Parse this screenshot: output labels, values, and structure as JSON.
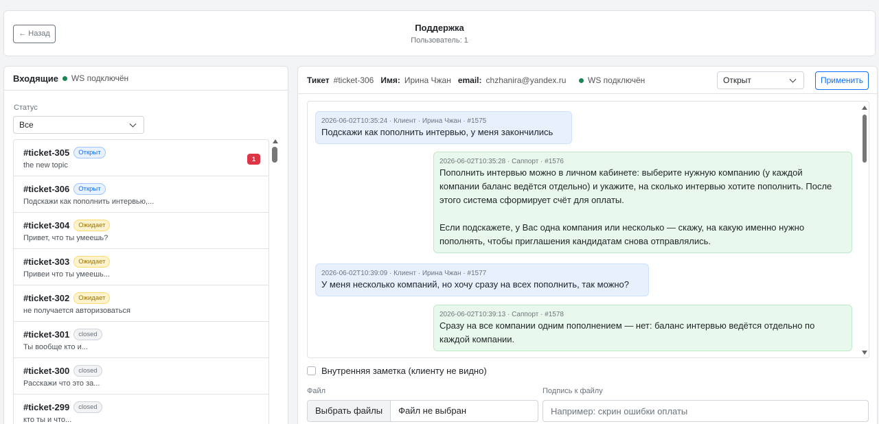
{
  "header": {
    "back_label": "← Назад",
    "title": "Поддержка",
    "subtitle": "Пользователь: 1"
  },
  "inbox": {
    "title": "Входящие",
    "ws_status": "WS подключён",
    "status_label": "Статус",
    "status_value": "Все",
    "tickets": [
      {
        "id": "#ticket-305",
        "status": "Открыт",
        "status_kind": "open",
        "preview": "the new topic",
        "unread": "1"
      },
      {
        "id": "#ticket-306",
        "status": "Открыт",
        "status_kind": "open",
        "preview": "Подскажи как пополнить интервью,..."
      },
      {
        "id": "#ticket-304",
        "status": "Ожидает",
        "status_kind": "wait",
        "preview": "Привет, что ты умеешь?"
      },
      {
        "id": "#ticket-303",
        "status": "Ожидает",
        "status_kind": "wait",
        "preview": "Привеи что ты умеешь..."
      },
      {
        "id": "#ticket-302",
        "status": "Ожидает",
        "status_kind": "wait",
        "preview": "не получается авторизоваться"
      },
      {
        "id": "#ticket-301",
        "status": "closed",
        "status_kind": "closed",
        "preview": "Ты вообще кто и..."
      },
      {
        "id": "#ticket-300",
        "status": "closed",
        "status_kind": "closed",
        "preview": "Расскажи что это за..."
      },
      {
        "id": "#ticket-299",
        "status": "closed",
        "status_kind": "closed",
        "preview": "кто ты и что..."
      }
    ]
  },
  "ticket": {
    "label": "Тикет",
    "id": "#ticket-306",
    "name_label": "Имя:",
    "name": "Ирина Чжан",
    "email_label": "email:",
    "email": "chzhanira@yandex.ru",
    "ws_status": "WS подключён",
    "status_value": "Открыт",
    "apply_label": "Применить",
    "messages": [
      {
        "role": "client",
        "meta": "2026-06-02T10:35:24 · Клиент · Ирина Чжан · #1575",
        "lines": [
          "Подскажи как пополнить интервью, у меня закончились"
        ]
      },
      {
        "role": "support",
        "meta": "2026-06-02T10:35:28 · Саппорт · #1576",
        "lines": [
          "Пополнить интервью можно в личном кабинете: выберите нужную компанию (у каждой",
          "компании баланс ведётся отдельно) и укажите, на сколько интервью хотите пополнить. После",
          "этого система сформирует счёт для оплаты.",
          "",
          "Если подскажете, у Вас одна компания или несколько — скажу, на какую именно нужно",
          "пополнять, чтобы приглашения кандидатам снова отправлялись."
        ]
      },
      {
        "role": "client",
        "meta": "2026-06-02T10:39:09 · Клиент · Ирина Чжан · #1577",
        "lines": [
          "У меня несколько компаний, но хочу сразу на всех пополнить, так можно?"
        ]
      },
      {
        "role": "support",
        "meta": "2026-06-02T10:39:13 · Саппорт · #1578",
        "lines": [
          "Сразу на все компании одним пополнением — нет: баланс интервью ведётся отдельно по",
          "каждой компании."
        ]
      }
    ],
    "internal_note_label": "Внутренняя заметка (клиенту не видно)",
    "file_label": "Файл",
    "file_button": "Выбрать файлы",
    "file_none": "Файл не выбран",
    "caption_label": "Подпись к файлу",
    "caption_placeholder": "Например: скрин ошибки оплаты"
  },
  "colors": {
    "accent": "#0d6efd",
    "ws_dot": "#198754",
    "unread": "#dc3545",
    "client_bubble": "#e8f0fe",
    "support_bubble": "#e8f8ec"
  }
}
